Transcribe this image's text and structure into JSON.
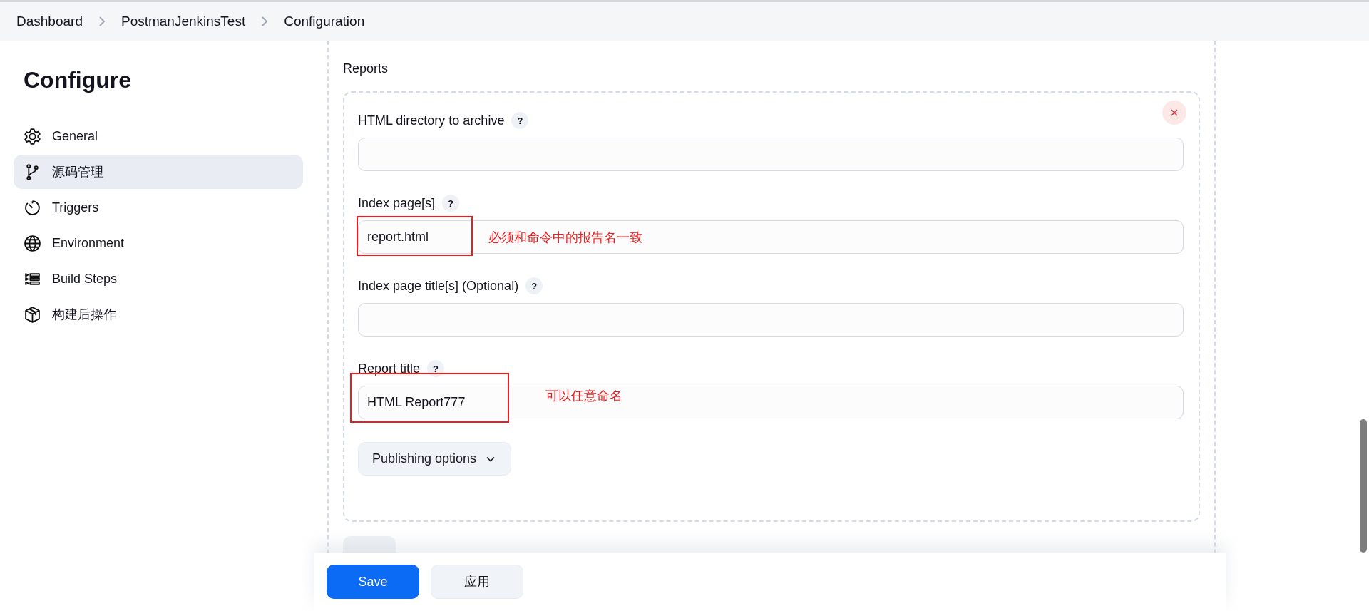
{
  "breadcrumbs": [
    {
      "label": "Dashboard"
    },
    {
      "label": "PostmanJenkinsTest"
    },
    {
      "label": "Configuration"
    }
  ],
  "sidebar": {
    "title": "Configure",
    "items": [
      {
        "label": "General",
        "kind": "gear",
        "selected": false
      },
      {
        "label": "源码管理",
        "kind": "branch",
        "selected": true
      },
      {
        "label": "Triggers",
        "kind": "timer",
        "selected": false
      },
      {
        "label": "Environment",
        "kind": "globe",
        "selected": false
      },
      {
        "label": "Build Steps",
        "kind": "list",
        "selected": false
      },
      {
        "label": "构建后操作",
        "kind": "package",
        "selected": false
      }
    ]
  },
  "section": {
    "title": "Reports",
    "fields": [
      {
        "label": "HTML directory to archive",
        "help": "?"
      },
      {
        "label": "Index page[s]",
        "help": "?",
        "value": "report.html",
        "annotation": "必须和命令中的报告名一致"
      },
      {
        "label": "Index page title[s] (Optional)",
        "help": "?"
      },
      {
        "label": "Report title",
        "help": "?",
        "value": "HTML Report777",
        "annotation": "可以任意命名"
      }
    ],
    "options_button": "Publishing options"
  },
  "footer": {
    "save": "Save",
    "apply": "应用"
  }
}
